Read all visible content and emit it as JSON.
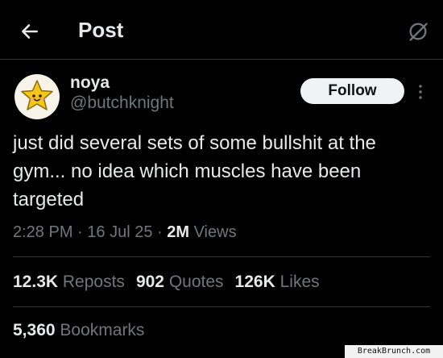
{
  "header": {
    "title": "Post",
    "back_icon": "arrow-left-icon",
    "grok_icon": "grok-icon"
  },
  "author": {
    "display_name": "noya",
    "handle": "@butchknight",
    "avatar_icon": "star-character-avatar",
    "follow_label": "Follow",
    "more_icon": "more-vertical-icon"
  },
  "post": {
    "text": "just did several sets of some bullshit at the gym... no idea which muscles have been targeted",
    "time": "2:28 PM",
    "sep1": " · ",
    "date": "16 Jul 25",
    "sep2": " · ",
    "views_count": "2M",
    "views_label": "Views"
  },
  "stats": {
    "reposts": {
      "count": "12.3K",
      "label": "Reposts"
    },
    "quotes": {
      "count": "902",
      "label": "Quotes"
    },
    "likes": {
      "count": "126K",
      "label": "Likes"
    },
    "bookmarks": {
      "count": "5,360",
      "label": "Bookmarks"
    }
  },
  "watermark": "BreakBrunch.com",
  "colors": {
    "background": "#000000",
    "text": "#e7e9ea",
    "muted": "#71767b",
    "divider": "#2f3336",
    "button_bg": "#eff3f4"
  }
}
